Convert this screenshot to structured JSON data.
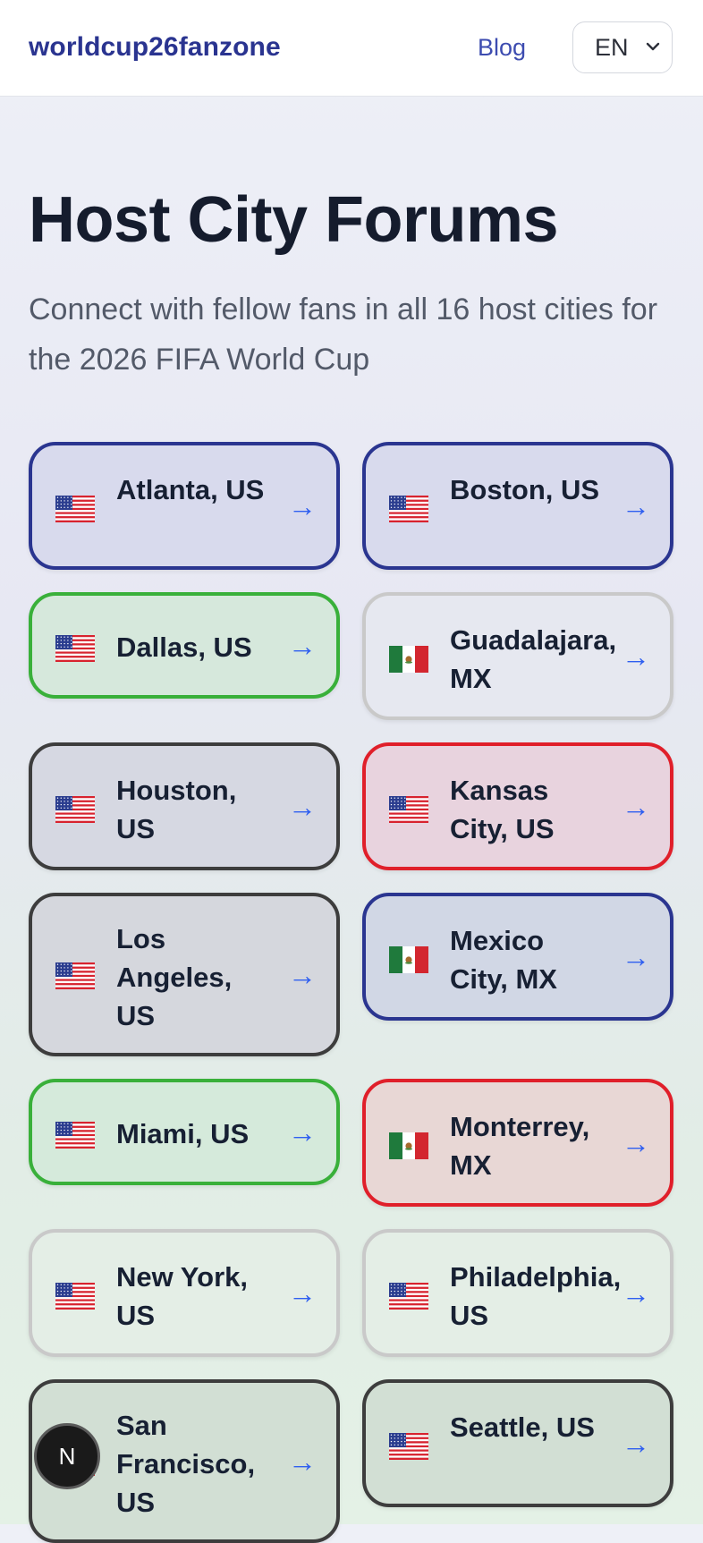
{
  "header": {
    "brand": "worldcup26fanzone",
    "blog_label": "Blog",
    "language": "EN"
  },
  "main": {
    "title": "Host City Forums",
    "subtitle": "Connect with fellow fans in all 16 host cities for the 2026 FIFA World Cup"
  },
  "cities": [
    {
      "name": "Atlanta, US",
      "flag": "us-flag-icon",
      "border": "#2a3590",
      "bg": "#d8daed"
    },
    {
      "name": "Boston, US",
      "flag": "us-flag-icon",
      "border": "#2a3590",
      "bg": "#d8daed"
    },
    {
      "name": "Dallas, US",
      "flag": "us-flag-icon",
      "border": "#39b03a",
      "bg": "#d6e8dc"
    },
    {
      "name": "Guadalajara, MX",
      "flag": "mexico-flag-icon",
      "border": "#c9c9c9",
      "bg": "#e6e8f0"
    },
    {
      "name": "Houston, US",
      "flag": "us-flag-icon",
      "border": "#3d3d3d",
      "bg": "#d6d8e2"
    },
    {
      "name": "Kansas City, US",
      "flag": "us-flag-icon",
      "border": "#e01f2a",
      "bg": "#e8d3de"
    },
    {
      "name": "Los Angeles, US",
      "flag": "us-flag-icon",
      "border": "#3d3d3d",
      "bg": "#d5d7dd"
    },
    {
      "name": "Mexico City, MX",
      "flag": "mexico-flag-icon",
      "border": "#2a3590",
      "bg": "#d1d7e5"
    },
    {
      "name": "Miami, US",
      "flag": "us-flag-icon",
      "border": "#39b03a",
      "bg": "#d5eadb"
    },
    {
      "name": "Monterrey, MX",
      "flag": "mexico-flag-icon",
      "border": "#e01f2a",
      "bg": "#e8d7d5"
    },
    {
      "name": "New York, US",
      "flag": "us-flag-icon",
      "border": "#c9c9c9",
      "bg": "#e4eee6"
    },
    {
      "name": "Philadelphia, US",
      "flag": "us-flag-icon",
      "border": "#c9c9c9",
      "bg": "#e4eee6"
    },
    {
      "name": "San Francisco, US",
      "flag": "us-flag-icon",
      "border": "#3d3d3d",
      "bg": "#d2dfd4"
    },
    {
      "name": "Seattle, US",
      "flag": "us-flag-icon",
      "border": "#3d3d3d",
      "bg": "#d2dfd4"
    }
  ],
  "arrow_glyph": "→",
  "fab_label": "N",
  "colors": {
    "brand": "#2a3490",
    "link": "#3d4cb0",
    "arrow": "#2f5ff0",
    "title": "#151c2d"
  }
}
